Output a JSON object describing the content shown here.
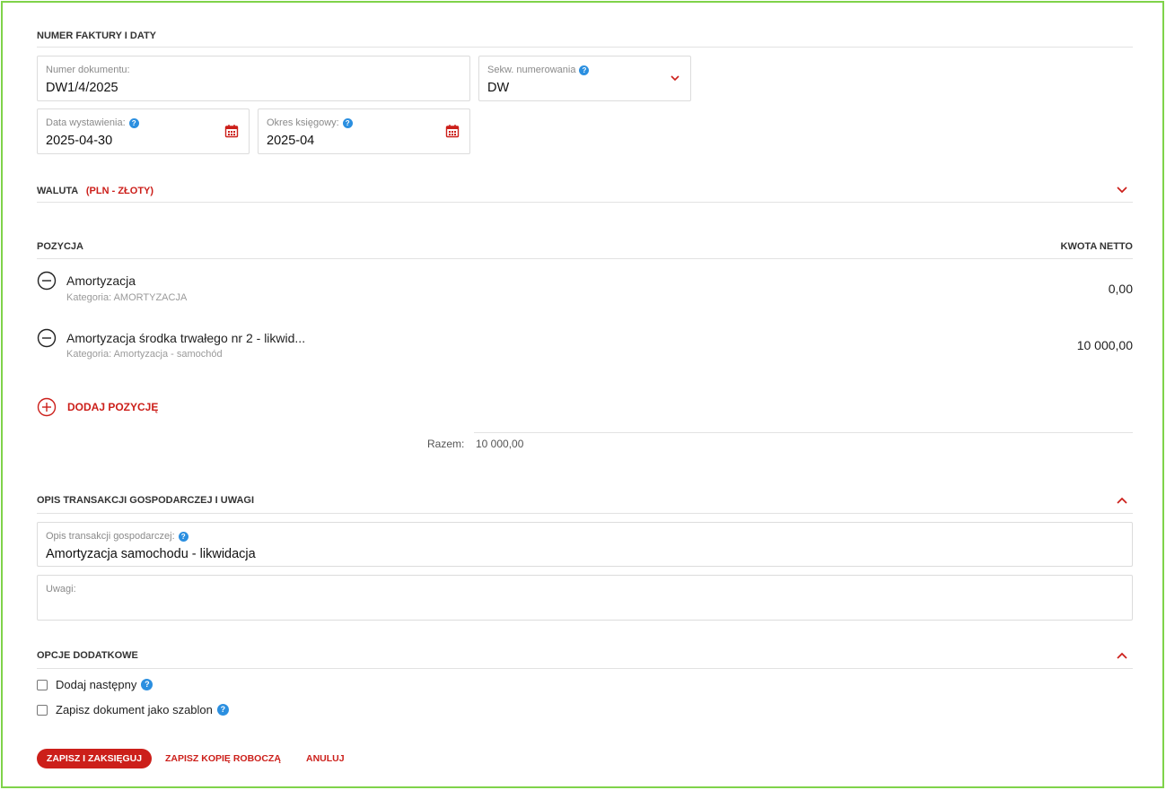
{
  "invoice_section": {
    "title": "NUMER FAKTURY I DATY",
    "document_number": {
      "label": "Numer dokumentu:",
      "value": "DW1/4/2025"
    },
    "numbering_sequence": {
      "label": "Sekw. numerowania",
      "value": "DW"
    },
    "issue_date": {
      "label": "Data wystawienia:",
      "value": "2025-04-30"
    },
    "accounting_period": {
      "label": "Okres księgowy:",
      "value": "2025-04"
    }
  },
  "currency_section": {
    "title": "WALUTA",
    "value": "(PLN - ZŁOTY)"
  },
  "items_section": {
    "col_item": "POZYCJA",
    "col_amount": "KWOTA NETTO",
    "items": [
      {
        "name": "Amortyzacja",
        "category": "Kategoria: AMORTYZACJA",
        "amount": "0,00"
      },
      {
        "name": "Amortyzacja środka trwałego nr 2 - likwid...",
        "category": "Kategoria: Amortyzacja - samochód",
        "amount": "10 000,00"
      }
    ],
    "add_label": "DODAJ POZYCJĘ",
    "total_label": "Razem:",
    "total_value": "10 000,00"
  },
  "description_section": {
    "title": "OPIS TRANSAKCJI GOSPODARCZEJ I UWAGI",
    "description": {
      "label": "Opis transakcji gospodarczej:",
      "value": "Amortyzacja samochodu - likwidacja"
    },
    "notes": {
      "label": "Uwagi:",
      "value": ""
    }
  },
  "options_section": {
    "title": "OPCJE DODATKOWE",
    "add_next": "Dodaj następny",
    "save_template": "Zapisz dokument jako szablon"
  },
  "actions": {
    "save_post": "ZAPISZ I ZAKSIĘGUJ",
    "save_draft": "ZAPISZ KOPIĘ ROBOCZĄ",
    "cancel": "ANULUJ"
  },
  "colors": {
    "accent": "#cc1f1a",
    "help": "#2b8fe0",
    "frame": "#7fd34a"
  }
}
